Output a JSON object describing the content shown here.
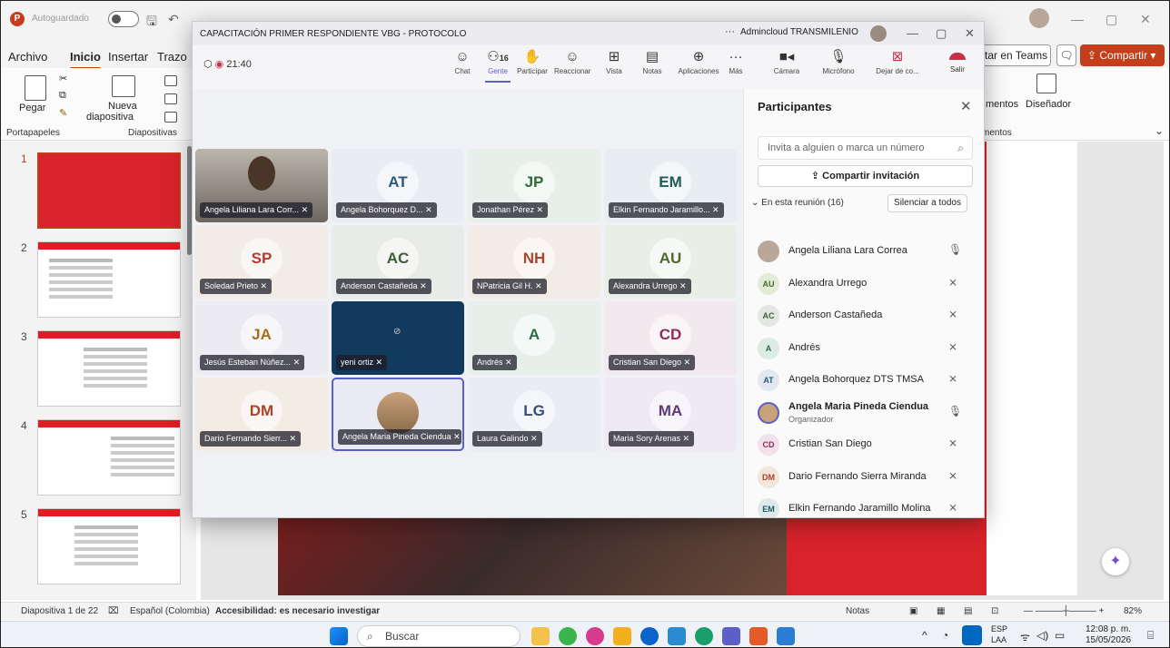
{
  "pp": {
    "autosave": "Autoguardado",
    "menu": [
      "Archivo",
      "Inicio",
      "Insertar",
      "Trazo"
    ],
    "teams_btn": "tar en Teams",
    "share": "Compartir",
    "ribbon": {
      "pegar": "Pegar",
      "nueva": "Nueva",
      "diapositiva": "diapositiva",
      "portapapeles": "Portapapeles",
      "diapositivas": "Diapositivas",
      "mentos": "mentos",
      "disenador": "Diseñador",
      "mentos2": "mentos"
    },
    "thumbs": [
      "1",
      "2",
      "3",
      "4",
      "5"
    ],
    "status": {
      "slide": "Diapositiva 1 de 22",
      "lang": "Español (Colombia)",
      "access": "Accesibilidad: es necesario investigar",
      "notas": "Notas",
      "zoom": "82%"
    }
  },
  "taskbar": {
    "search": "Buscar",
    "lang1": "ESP",
    "lang2": "LAA",
    "time": "12:08 p. m.",
    "date": "15/05/2026"
  },
  "teams": {
    "title": "CAPACITACIÓN PRIMER RESPONDIENTE VBG - PROTOCOLO",
    "account": "Admincloud TRANSMILENIO",
    "timer": "21:40",
    "toolbar": {
      "chat": "Chat",
      "gente": "Gente",
      "gente_count": "16",
      "participar": "Participar",
      "reaccionar": "Reaccionar",
      "vista": "Vista",
      "notas": "Notas",
      "aplicaciones": "Aplicaciones",
      "mas": "Más",
      "camara": "Cámara",
      "microfono": "Micrófono",
      "dejar": "Dejar de co...",
      "salir": "Salir"
    },
    "tiles": [
      {
        "initials": "",
        "name": "Angela Liliana Lara Corr...",
        "bg": "#8a8a8a",
        "color": "#333"
      },
      {
        "initials": "AT",
        "name": "Angela Bohorquez D...",
        "bg": "#e9ecf3",
        "color": "#2b5a7a"
      },
      {
        "initials": "JP",
        "name": "Jonathan Pérez",
        "bg": "#e6efe9",
        "color": "#2f6b3c"
      },
      {
        "initials": "EM",
        "name": "Elkin Fernando Jaramillo...",
        "bg": "#e7edf0",
        "color": "#1f5a5a"
      },
      {
        "initials": "SP",
        "name": "Soledad Prieto",
        "bg": "#f1ede6",
        "color": "#b53a2c"
      },
      {
        "initials": "AC",
        "name": "Anderson Castañeda",
        "bg": "#e8ebe7",
        "color": "#3e5e3e"
      },
      {
        "initials": "NH",
        "name": "NPatricia Gil H.",
        "bg": "#f3ebe6",
        "color": "#a8452a"
      },
      {
        "initials": "AU",
        "name": "Alexandra Urrego",
        "bg": "#e9efe6",
        "color": "#4d6b2a"
      },
      {
        "initials": "JA",
        "name": "Jesús Esteban Núñez...",
        "bg": "#ecebf2",
        "color": "#a6701a"
      },
      {
        "initials": "",
        "name": "yeni ortiz",
        "bg": "#123a5c",
        "color": "#fff"
      },
      {
        "initials": "A",
        "name": "Andrés",
        "bg": "#e6efea",
        "color": "#2f6b4a"
      },
      {
        "initials": "CD",
        "name": "Cristian San Diego",
        "bg": "#f2e9ee",
        "color": "#8f2c5a"
      },
      {
        "initials": "DM",
        "name": "Dario Fernando Sierr...",
        "bg": "#f2ece4",
        "color": "#a8452a"
      },
      {
        "initials": "",
        "name": "Angela Maria Pineda Ciendua",
        "bg": "#e9eaf3",
        "color": "#333"
      },
      {
        "initials": "LG",
        "name": "Laura Galindo",
        "bg": "#e9ecf3",
        "color": "#3a4a7a"
      },
      {
        "initials": "MA",
        "name": "Maria Sory Arenas",
        "bg": "#efe9f3",
        "color": "#5e3a7a"
      }
    ],
    "panel": {
      "title": "Participantes",
      "invite_placeholder": "Invita a alguien o marca un número",
      "share_invite": "Compartir invitación",
      "in_meeting": "En esta reunión (16)",
      "mute_all": "Silenciar a todos",
      "organizer": "Organizador",
      "people": [
        {
          "initials": "",
          "name": "Angela Liliana Lara Correa",
          "av_bg": "#b9a89a",
          "av_color": "#fff"
        },
        {
          "initials": "AU",
          "name": "Alexandra Urrego",
          "av_bg": "#e3ecd9",
          "av_color": "#4d6b2a"
        },
        {
          "initials": "AC",
          "name": "Anderson Castañeda",
          "av_bg": "#e3e7e1",
          "av_color": "#3e5e3e"
        },
        {
          "initials": "A",
          "name": "Andrés",
          "av_bg": "#dcece4",
          "av_color": "#2f6b4a"
        },
        {
          "initials": "AT",
          "name": "Angela Bohorquez DTS TMSA",
          "av_bg": "#e3e7ef",
          "av_color": "#2b5a7a"
        },
        {
          "initials": "",
          "name": "Angela Maria Pineda Ciendua",
          "av_bg": "#c9a27a",
          "av_color": "#fff"
        },
        {
          "initials": "CD",
          "name": "Cristian San Diego",
          "av_bg": "#f1e1ea",
          "av_color": "#8f2c5a"
        },
        {
          "initials": "DM",
          "name": "Dario Fernando Sierra Miranda",
          "av_bg": "#f1e6d9",
          "av_color": "#a8452a"
        },
        {
          "initials": "EM",
          "name": "Elkin Fernando Jaramillo Molina",
          "av_bg": "#dfe9ec",
          "av_color": "#1f5a5a"
        }
      ]
    }
  }
}
